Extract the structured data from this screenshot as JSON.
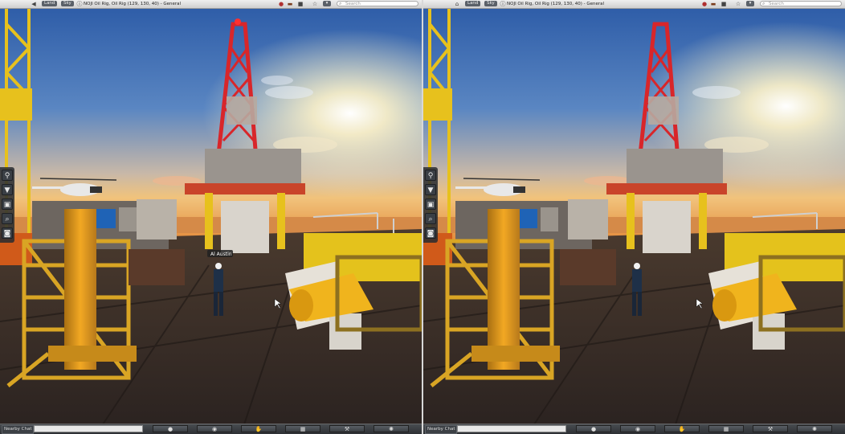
{
  "viewer": {
    "land_label": "Land",
    "sky_label": "Sky",
    "location": "NOJI Oil Rig, Oil Rig (129, 130, 40) - General",
    "search_placeholder": "Search",
    "nearby_chat_label": "Nearby Chat",
    "avatar_name": "Al Austin"
  },
  "icons": {
    "back": "back-arrow-icon",
    "home": "home-icon",
    "info": "info-icon",
    "star": "star-icon",
    "sidebar": [
      "place-pin-icon",
      "shirt-icon",
      "inventory-icon",
      "search-icon",
      "camera-icon"
    ],
    "bottom": [
      "speak-icon",
      "view-eye-icon",
      "gesture-icon",
      "map-icon",
      "build-hammer-icon",
      "minimap-icon"
    ]
  },
  "colors": {
    "sky_top": "#2e5aa8",
    "sky_horizon": "#f3d8a0",
    "sun": "#fff6d8",
    "derrick_red": "#d8262a",
    "crane_yellow": "#e7c11d",
    "deck": "#3a2f27"
  }
}
